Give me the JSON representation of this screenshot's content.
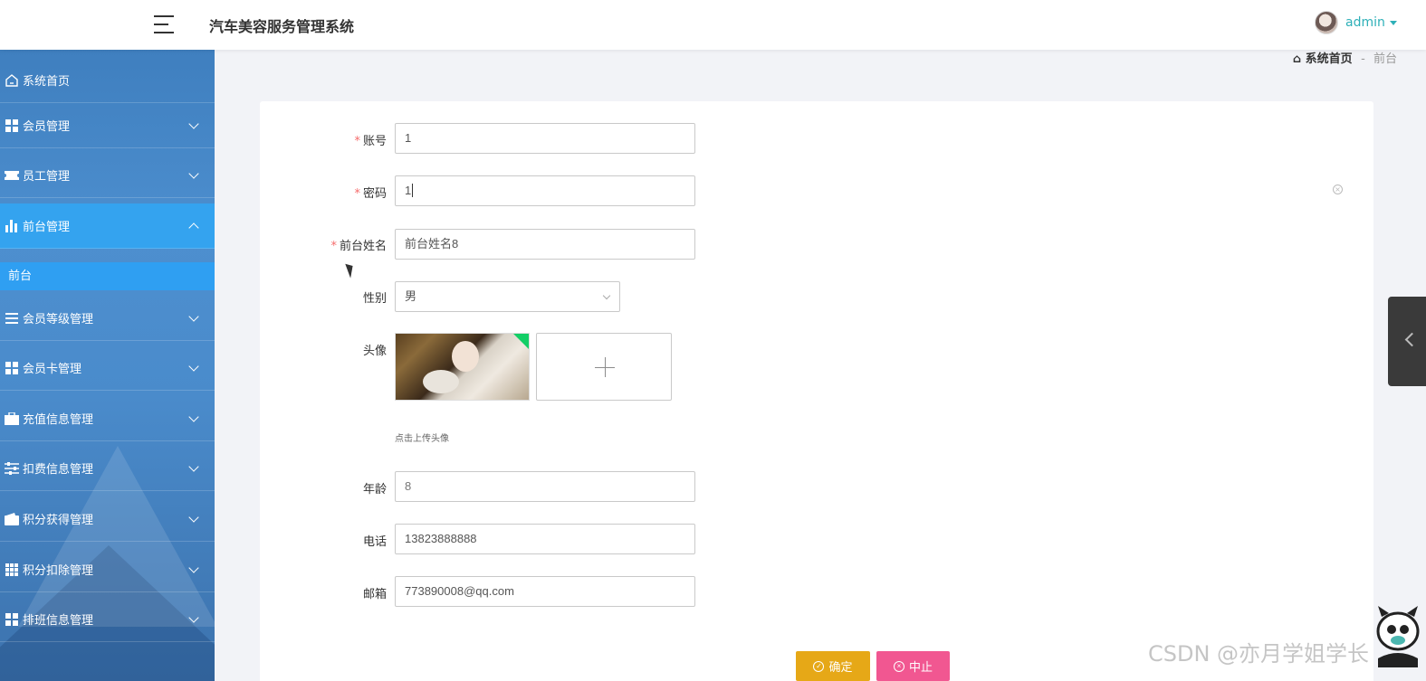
{
  "header": {
    "app_title": "汽车美容服务管理系统",
    "username": "admin"
  },
  "sidebar": {
    "items": [
      {
        "label": "系统首页",
        "icon": "home-icon"
      },
      {
        "label": "会员管理",
        "icon": "grid-icon"
      },
      {
        "label": "员工管理",
        "icon": "ticket-icon"
      },
      {
        "label": "前台管理",
        "icon": "bar-chart-icon",
        "active": true
      },
      {
        "label": "会员等级管理",
        "icon": "list-icon"
      },
      {
        "label": "会员卡管理",
        "icon": "grid-icon"
      },
      {
        "label": "充值信息管理",
        "icon": "briefcase-icon"
      },
      {
        "label": "扣费信息管理",
        "icon": "sliders-icon"
      },
      {
        "label": "积分获得管理",
        "icon": "wallet-icon"
      },
      {
        "label": "积分扣除管理",
        "icon": "grid9-icon"
      },
      {
        "label": "排班信息管理",
        "icon": "grid-icon"
      }
    ],
    "sub_item": "前台"
  },
  "breadcrumb": {
    "home": "系统首页",
    "separator": "-",
    "current": "前台"
  },
  "form": {
    "account": {
      "label": "账号",
      "value": "1"
    },
    "password": {
      "label": "密码",
      "value": "1"
    },
    "name": {
      "label": "前台姓名",
      "value": "前台姓名8"
    },
    "gender": {
      "label": "性别",
      "value": "男"
    },
    "avatar": {
      "label": "头像",
      "hint": "点击上传头像"
    },
    "age": {
      "label": "年龄",
      "value": "8"
    },
    "phone": {
      "label": "电话",
      "value": "13823888888"
    },
    "email": {
      "label": "邮箱",
      "value": "773890008@qq.com"
    },
    "required_mark": "*"
  },
  "buttons": {
    "confirm": "确定",
    "cancel": "中止"
  },
  "watermark": "CSDN @亦月学姐学长",
  "colors": {
    "accent": "#2eb0b8",
    "sidebar_active": "#34a3ef",
    "confirm_btn": "#e6a817",
    "cancel_btn": "#f15791"
  }
}
